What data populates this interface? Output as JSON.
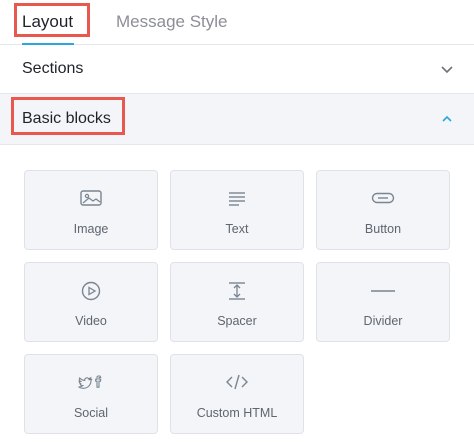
{
  "tabs": {
    "layout": "Layout",
    "message_style": "Message Style"
  },
  "sections": {
    "title": "Sections",
    "state": "collapsed"
  },
  "basic_blocks": {
    "title": "Basic blocks",
    "state": "expanded",
    "tiles": [
      {
        "label": "Image",
        "icon": "image-icon"
      },
      {
        "label": "Text",
        "icon": "text-icon"
      },
      {
        "label": "Button",
        "icon": "button-icon"
      },
      {
        "label": "Video",
        "icon": "video-icon"
      },
      {
        "label": "Spacer",
        "icon": "spacer-icon"
      },
      {
        "label": "Divider",
        "icon": "divider-icon"
      },
      {
        "label": "Social",
        "icon": "social-icon"
      },
      {
        "label": "Custom HTML",
        "icon": "code-icon"
      }
    ]
  },
  "colors": {
    "accent": "#2aa7df",
    "highlight": "#e8584e",
    "icon": "#7a8591"
  }
}
